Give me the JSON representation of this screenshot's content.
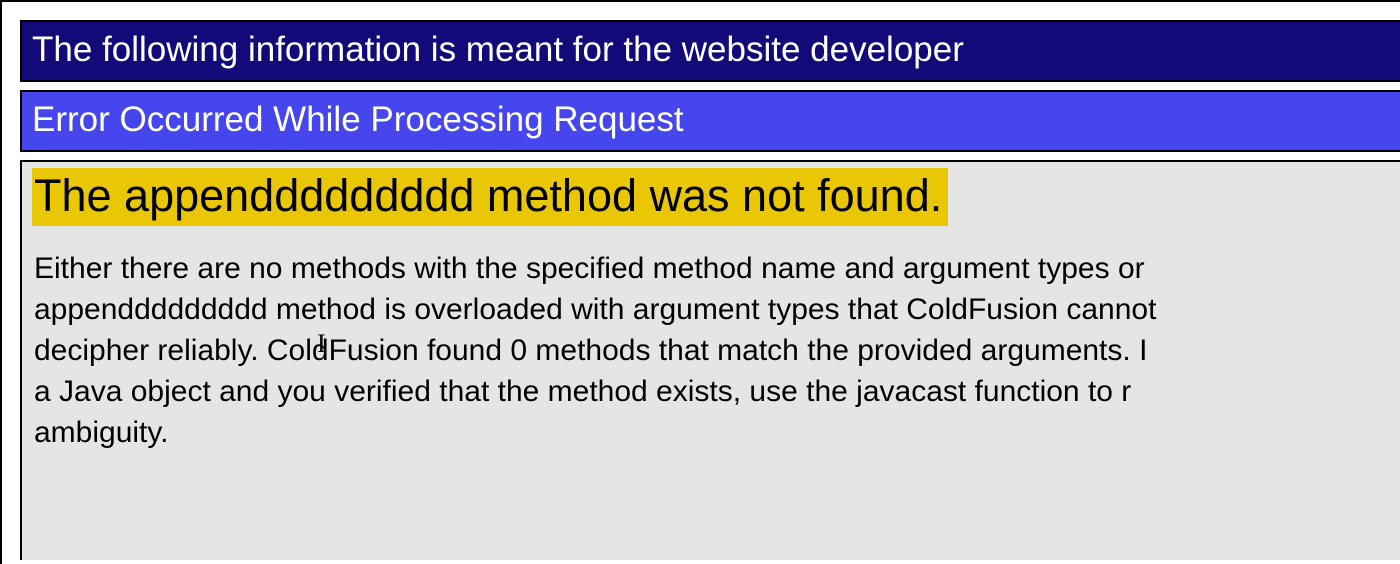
{
  "banners": {
    "developer_info": "The following information is meant for the website developer ",
    "error_title": "Error Occurred While Processing Request"
  },
  "error": {
    "headline": "The appenddddddddd method was not found.",
    "description_lines": [
      "Either there are no methods with the specified method name and argument types or",
      "appenddddddddd method is overloaded with argument types that ColdFusion cannot",
      "decipher reliably. ColdFusion found 0 methods that match the provided arguments. I",
      "a Java object and you verified that the method exists, use the javacast function to r",
      "ambiguity."
    ]
  },
  "cursor_glyph": "I"
}
